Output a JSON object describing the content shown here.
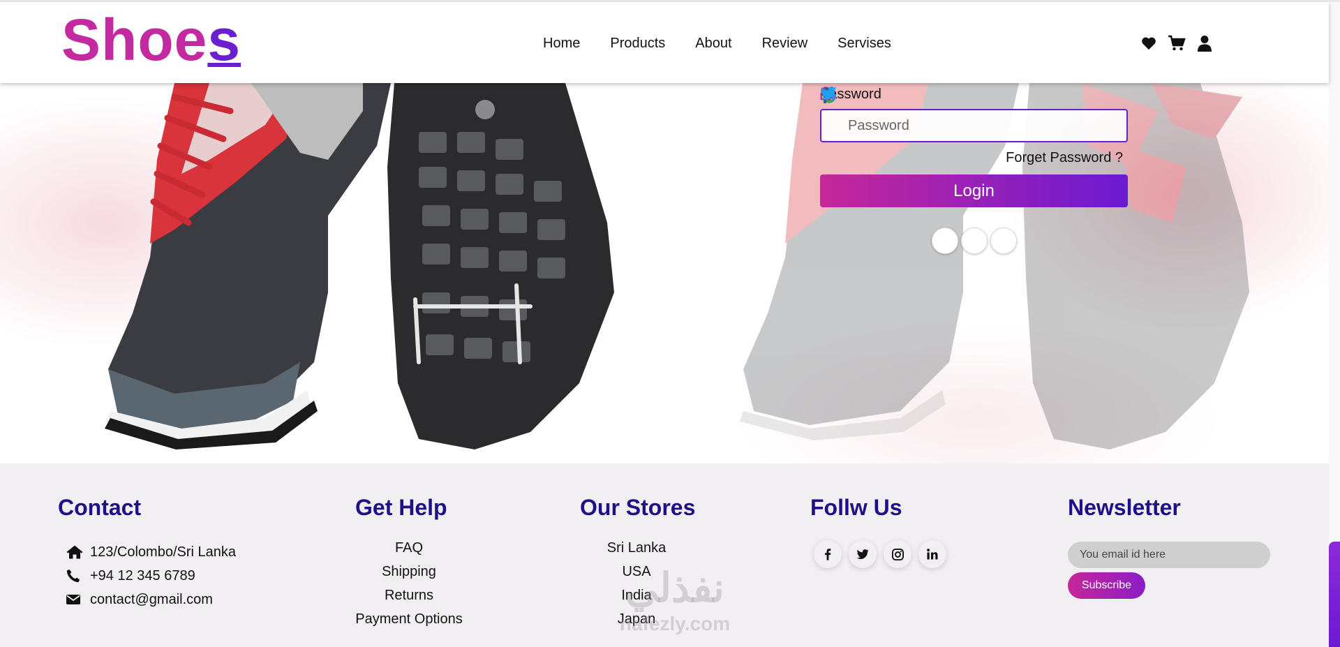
{
  "header": {
    "logo_main": "Shoe",
    "logo_last": "s",
    "nav": [
      "Home",
      "Products",
      "About",
      "Review",
      "Servises"
    ],
    "icons": [
      "heart-icon",
      "cart-icon",
      "user-icon"
    ]
  },
  "login": {
    "password_label": "Password",
    "password_placeholder": "Password",
    "forget_text": "Forget Password ?",
    "login_button": "Login",
    "social": [
      "google-icon",
      "facebook-icon",
      "twitter-icon"
    ]
  },
  "footer": {
    "contact": {
      "title": "Contact",
      "items": [
        {
          "icon": "home-icon",
          "text": "123/Colombo/Sri Lanka"
        },
        {
          "icon": "phone-icon",
          "text": "+94 12 345 6789"
        },
        {
          "icon": "envelope-icon",
          "text": "contact@gmail.com"
        }
      ]
    },
    "help": {
      "title": "Get Help",
      "items": [
        "FAQ",
        "Shipping",
        "Returns",
        "Payment Options"
      ]
    },
    "stores": {
      "title": "Our Stores",
      "items": [
        "Sri Lanka",
        "USA",
        "India",
        "Japan"
      ]
    },
    "follow": {
      "title": "Follw Us",
      "icons": [
        "facebook-icon",
        "twitter-icon",
        "instagram-icon",
        "linkedin-icon"
      ]
    },
    "newsletter": {
      "title": "Newsletter",
      "placeholder": "You email id here",
      "button": "Subscribe"
    }
  },
  "watermark": {
    "arabic": "نفذلي",
    "latin": "nafezly.com"
  },
  "colors": {
    "brand_pink": "#c42a9f",
    "brand_purple": "#6c1fd1",
    "footer_title": "#1e0f8a"
  }
}
